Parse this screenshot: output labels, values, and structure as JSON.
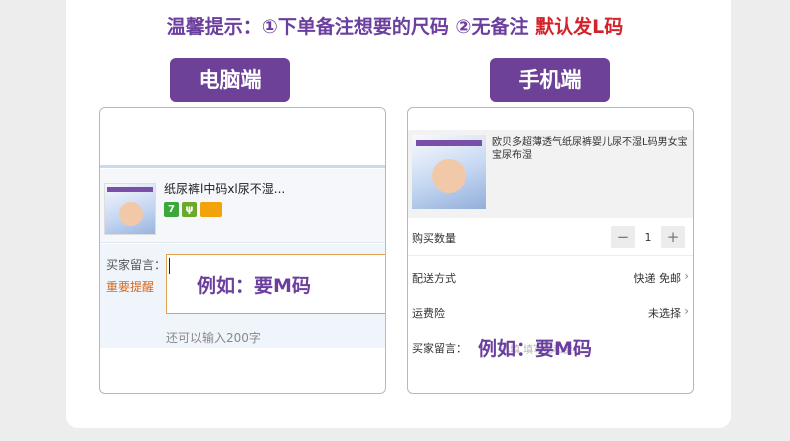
{
  "tip": {
    "text": "温馨提示：①下单备注想要的尺码 ②无备注 ",
    "highlight": "默认发L码"
  },
  "labels": {
    "desktop": "电脑端",
    "mobile": "手机端"
  },
  "desktop": {
    "product_title": "纸尿裤l中码xl尿不湿...",
    "icons": [
      "7",
      "ψ",
      "card"
    ],
    "message_label": "买家留言：",
    "message_warning": "重要提醒",
    "example": "例如：要M码",
    "char_count": "还可以输入200字"
  },
  "mobile": {
    "product_title": "欧贝多超薄透气纸尿裤婴儿尿不湿L码男女宝宝尿布湿",
    "quantity_label": "购买数量",
    "quantity_value": "1",
    "minus": "−",
    "plus": "+",
    "shipping_label": "配送方式",
    "shipping_value": "快递 免邮",
    "insurance_label": "运费险",
    "insurance_value": "未选择",
    "message_label": "买家留言：",
    "message_placeholder": "选填 填写已和卖...",
    "example": "例如：要M码",
    "chevron": "›"
  },
  "colors": {
    "accent_purple": "#6e4199",
    "warning_red": "#d3222a",
    "warning_orange": "#d36a1f"
  }
}
